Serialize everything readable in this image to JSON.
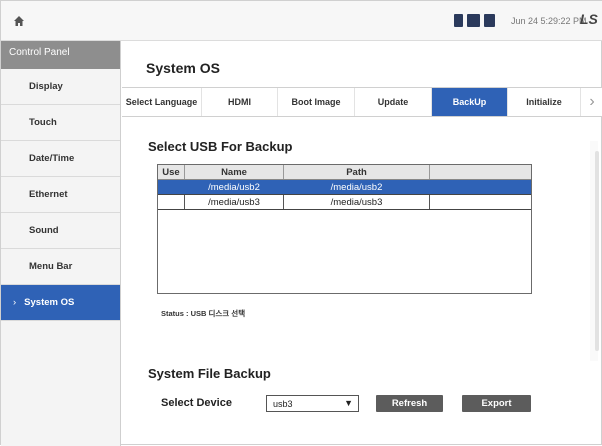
{
  "topbar": {
    "clock": "Jun 24 5:29:22 PM",
    "logo": "LS",
    "icons": [
      "home-icon",
      "status-icon-1",
      "status-icon-2",
      "status-icon-3"
    ]
  },
  "sidebar": {
    "header": "Control Panel",
    "items": [
      {
        "label": "Display"
      },
      {
        "label": "Touch"
      },
      {
        "label": "Date/Time"
      },
      {
        "label": "Ethernet"
      },
      {
        "label": "Sound"
      },
      {
        "label": "Menu Bar"
      },
      {
        "label": "System OS",
        "arrow": "›"
      }
    ]
  },
  "main": {
    "title": "System OS",
    "tabs": [
      {
        "label": "Select Language"
      },
      {
        "label": "HDMI"
      },
      {
        "label": "Boot Image"
      },
      {
        "label": "Update"
      },
      {
        "label": "BackUp"
      },
      {
        "label": "Initialize"
      }
    ],
    "tab_more": "›",
    "usb_section_title": "Select USB For Backup",
    "table": {
      "headers": [
        "Use",
        "Name",
        "Path"
      ],
      "rows": [
        {
          "use": "",
          "name": "/media/usb2",
          "path": "/media/usb2"
        },
        {
          "use": "",
          "name": "/media/usb3",
          "path": "/media/usb3"
        }
      ]
    },
    "status": "Status : USB 디스크 선택",
    "backup_section_title": "System File Backup",
    "select_device_label": "Select Device",
    "device_value": "usb3",
    "refresh_label": "Refresh",
    "export_label": "Export"
  },
  "colors": {
    "accent": "#2f62b6",
    "sidebar_header": "#8e8e8e",
    "button": "#5c5c5c"
  }
}
